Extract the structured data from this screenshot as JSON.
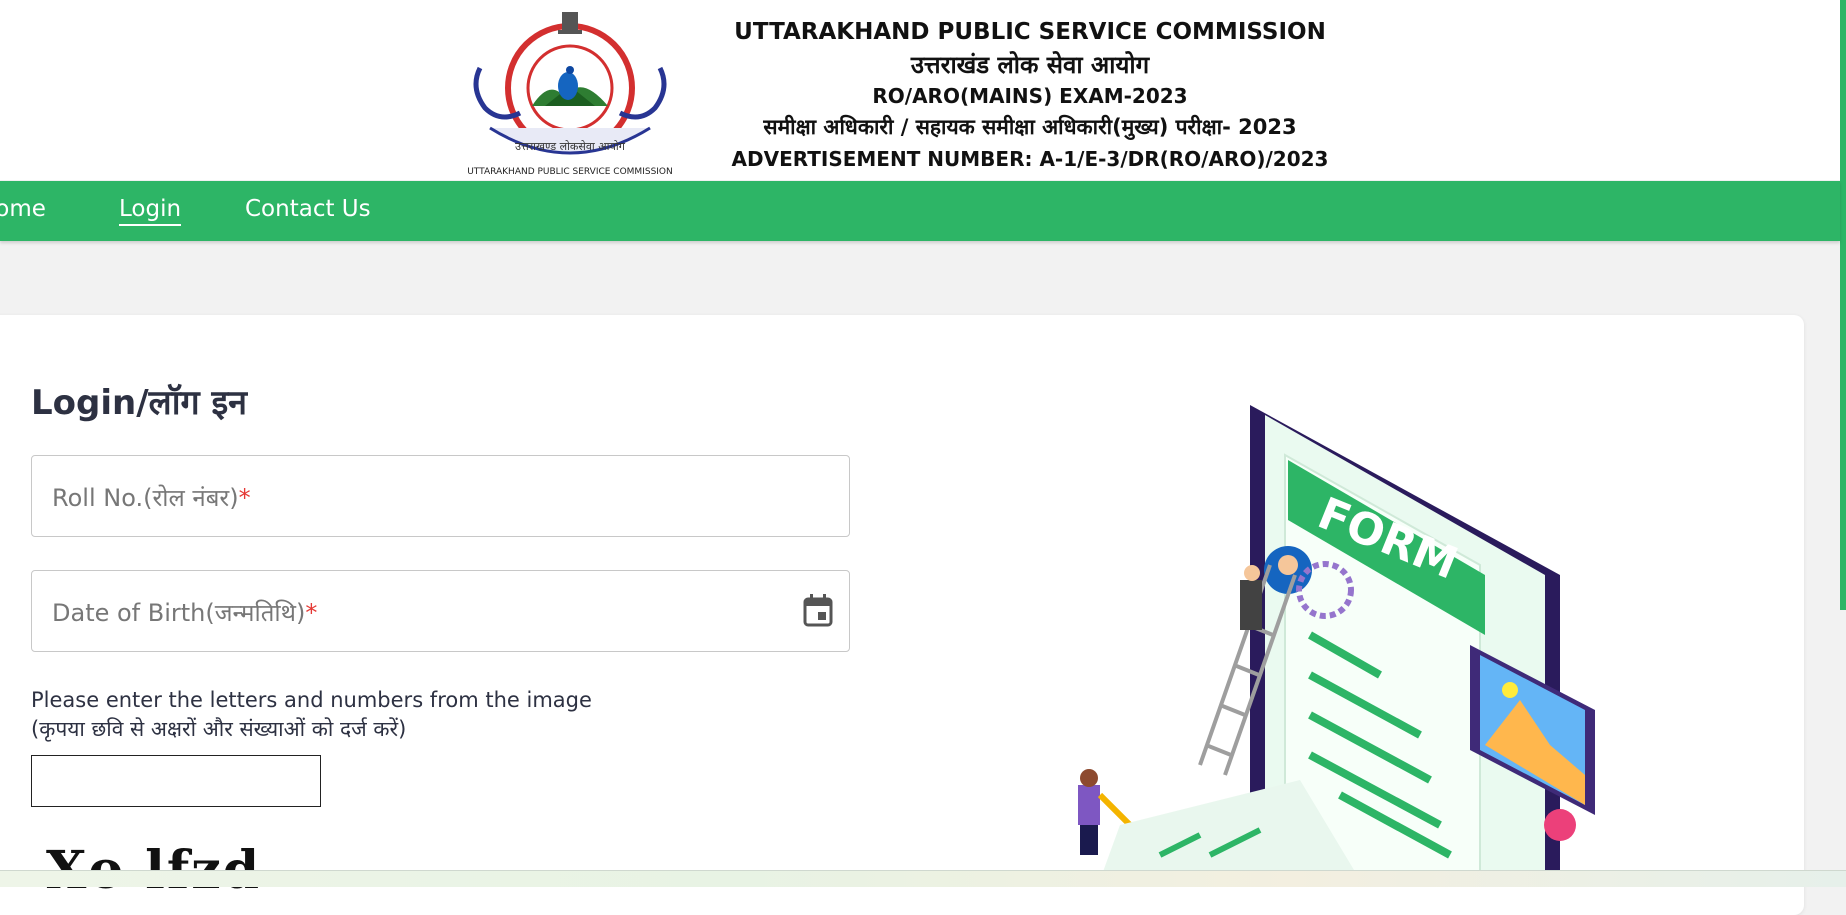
{
  "header": {
    "emblem_caption": "UTTARAKHAND PUBLIC SERVICE COMMISSION",
    "line1": "UTTARAKHAND PUBLIC SERVICE COMMISSION",
    "line2": "उत्तराखंड लोक सेवा आयोग",
    "line3": "RO/ARO(MAINS) EXAM-2023",
    "line4": "समीक्षा अधिकारी / सहायक समीक्षा अधिकारी(मुख्य) परीक्षा- 2023",
    "line5": "ADVERTISEMENT NUMBER:  A-1/E-3/DR(RO/ARO)/2023"
  },
  "nav": {
    "home": "Home",
    "login": "Login",
    "contact": "Contact Us",
    "active": "Login"
  },
  "login": {
    "title": "Login/लॉग इन",
    "roll_label": "Roll No.(रोल नंबर)",
    "dob_label": "Date of Birth(जन्मतिथि)",
    "required_mark": "*",
    "captcha_prompt_en": "Please enter the letters and numbers from the image",
    "captcha_prompt_hi": "(कृपया छवि से अक्षरों और संख्याओं को दर्ज करें)",
    "captcha_value": "",
    "captcha_text": "Xo lfzd"
  },
  "illustration": {
    "form_label": "FORM"
  },
  "icons": {
    "calendar": "calendar-icon",
    "emblem": "upsc-emblem"
  },
  "colors": {
    "brand_green": "#2db566",
    "required_red": "#e53935",
    "text_dark": "#2d3142"
  }
}
